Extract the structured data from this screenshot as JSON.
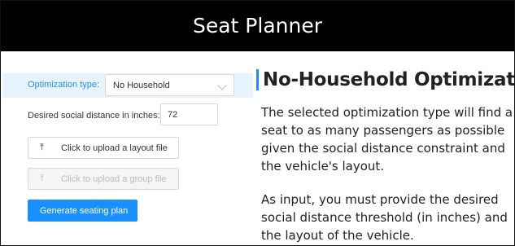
{
  "header": {
    "title": "Seat Planner"
  },
  "form": {
    "optimization_label": "Optimization type:",
    "optimization_value": "No Household",
    "distance_label": "Desired social distance in inches:",
    "distance_value": "72",
    "upload_layout_label": "Click to upload a layout file",
    "upload_group_label": "Click to upload a group file",
    "upload_icon": "upload-icon",
    "generate_label": "Generate seating plan"
  },
  "description": {
    "heading": "No-Household Optimization",
    "paragraph1": "The selected optimization type will find a seat to as many passengers as possible given the social distance constraint and the vehicle's layout.",
    "paragraph2": "As input, you must provide the desired social distance threshold (in inches) and the layout of the vehicle."
  },
  "colors": {
    "accent": "#1890ff",
    "header_bg": "#000000",
    "selected_row_bg": "#e8f4fd"
  }
}
